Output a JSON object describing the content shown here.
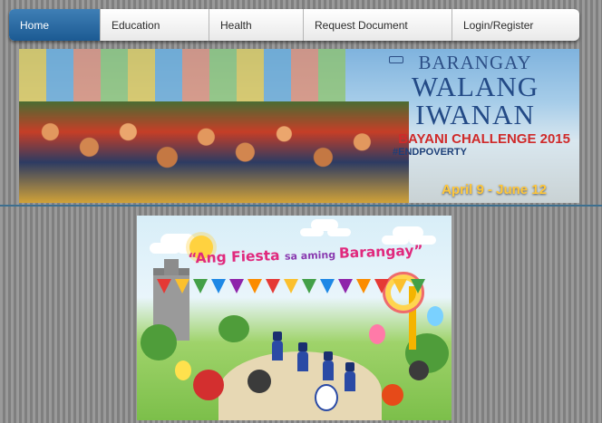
{
  "nav": {
    "items": [
      {
        "label": "Home",
        "active": true
      },
      {
        "label": "Education",
        "active": false
      },
      {
        "label": "Health",
        "active": false
      },
      {
        "label": "Request Document",
        "active": false
      },
      {
        "label": "Login/Register",
        "active": false
      }
    ],
    "active_color": "#2a6aa6"
  },
  "banner": {
    "line1": "BARANGAY",
    "line2": "WALANG",
    "line3": "IWANAN",
    "challenge": "BAYANI CHALLENGE 2015",
    "hashtag": "#ENDPOVERTY",
    "dates": "April 9 - June 12",
    "colors": {
      "title": "#234a86",
      "challenge": "#cf2a2a",
      "dates": "#ffc73a"
    }
  },
  "poster": {
    "title_part1": "“Ang Fiesta ",
    "title_part2": "sa aming ",
    "title_part3": "Barangay”",
    "title_color": "#e0297d"
  }
}
